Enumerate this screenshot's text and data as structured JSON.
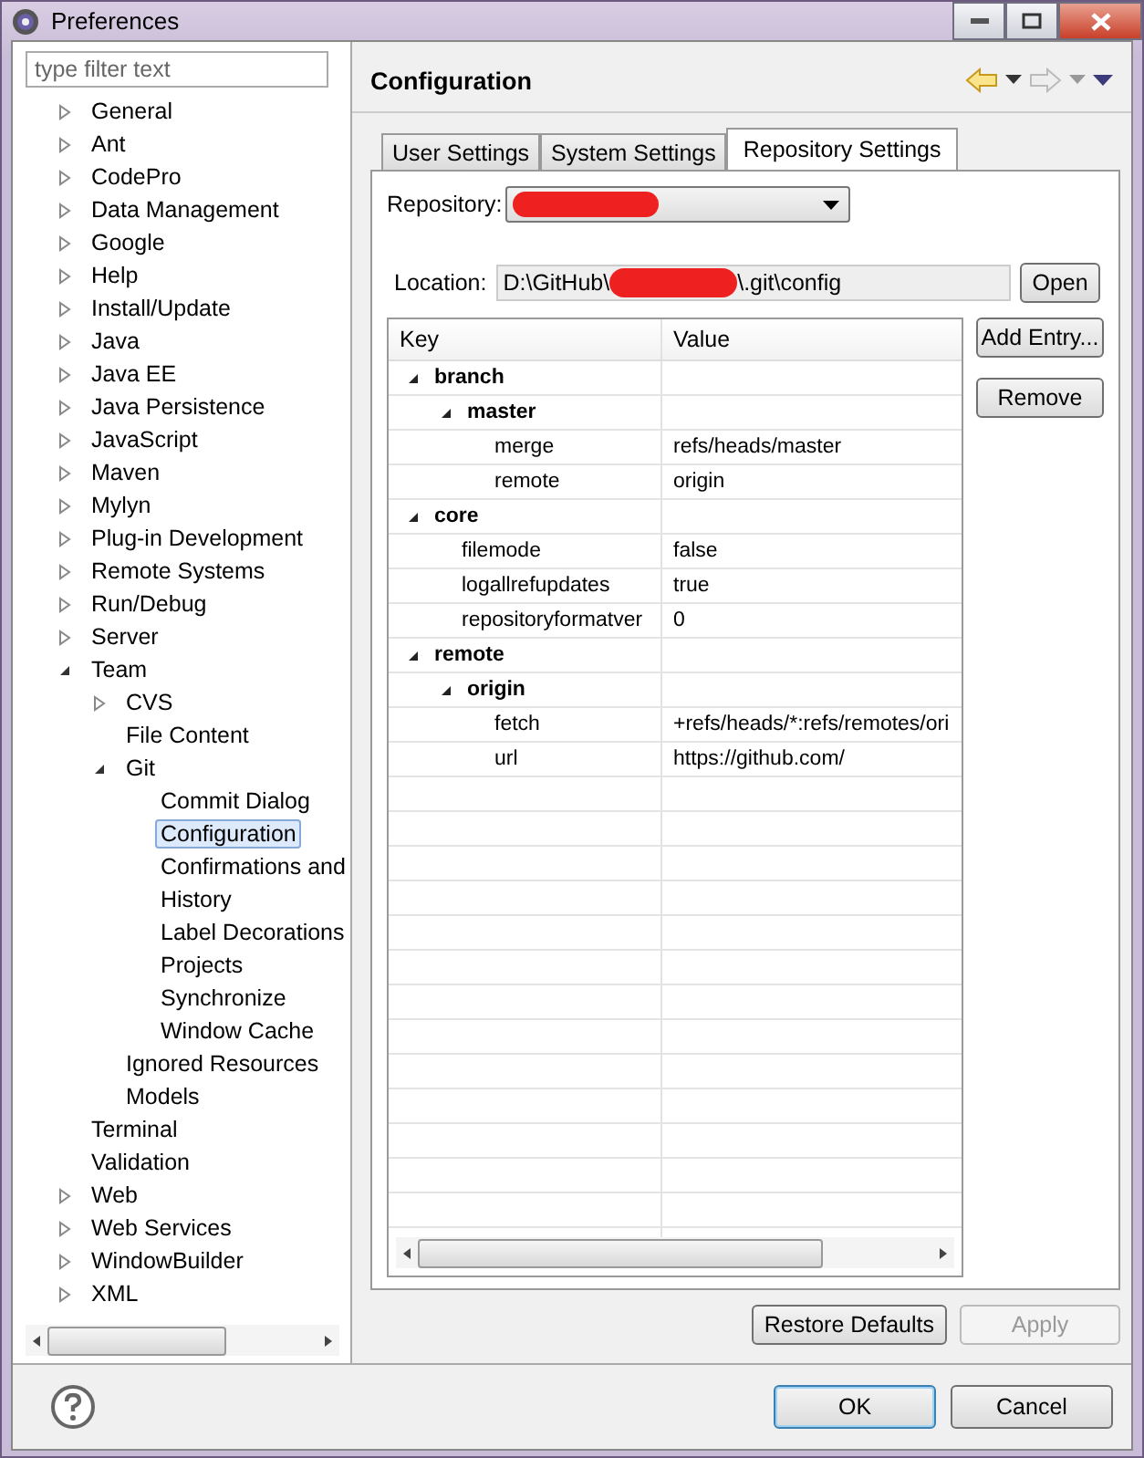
{
  "window": {
    "title": "Preferences"
  },
  "sidebar": {
    "filter": {
      "placeholder": "type filter text"
    },
    "items": [
      {
        "label": "General",
        "expanded": false
      },
      {
        "label": "Ant",
        "expanded": false
      },
      {
        "label": "CodePro",
        "expanded": false
      },
      {
        "label": "Data Management",
        "expanded": false
      },
      {
        "label": "Google",
        "expanded": false
      },
      {
        "label": "Help",
        "expanded": false
      },
      {
        "label": "Install/Update",
        "expanded": false
      },
      {
        "label": "Java",
        "expanded": false
      },
      {
        "label": "Java EE",
        "expanded": false
      },
      {
        "label": "Java Persistence",
        "expanded": false
      },
      {
        "label": "JavaScript",
        "expanded": false
      },
      {
        "label": "Maven",
        "expanded": false
      },
      {
        "label": "Mylyn",
        "expanded": false
      },
      {
        "label": "Plug-in Development",
        "expanded": false
      },
      {
        "label": "Remote Systems",
        "expanded": false
      },
      {
        "label": "Run/Debug",
        "expanded": false
      },
      {
        "label": "Server",
        "expanded": false
      },
      {
        "label": "Team",
        "expanded": true,
        "children": [
          {
            "label": "CVS",
            "expanded": false
          },
          {
            "label": "File Content"
          },
          {
            "label": "Git",
            "expanded": true,
            "children": [
              {
                "label": "Commit Dialog",
                "selected": false
              },
              {
                "label": "Configuration",
                "selected": true
              },
              {
                "label": "Confirmations and",
                "selected": false
              },
              {
                "label": "History",
                "selected": false
              },
              {
                "label": "Label Decorations",
                "selected": false
              },
              {
                "label": "Projects",
                "selected": false
              },
              {
                "label": "Synchronize",
                "selected": false
              },
              {
                "label": "Window Cache",
                "selected": false
              }
            ]
          },
          {
            "label": "Ignored Resources"
          },
          {
            "label": "Models"
          }
        ]
      },
      {
        "label": "Terminal"
      },
      {
        "label": "Validation"
      },
      {
        "label": "Web",
        "expanded": false
      },
      {
        "label": "Web Services",
        "expanded": false
      },
      {
        "label": "WindowBuilder",
        "expanded": false
      },
      {
        "label": "XML",
        "expanded": false
      }
    ]
  },
  "page": {
    "title": "Configuration",
    "tabs": [
      {
        "label": "User Settings",
        "selected": false
      },
      {
        "label": "System Settings",
        "selected": false
      },
      {
        "label": "Repository Settings",
        "selected": true
      }
    ],
    "repository": {
      "label": "Repository:"
    },
    "location": {
      "label": "Location:",
      "value_start": "D:\\GitHub\\",
      "value_end": "\\.git\\config"
    },
    "open_button": "Open",
    "table": {
      "columns": [
        "Key",
        "Value"
      ],
      "rows": [
        {
          "key": "branch",
          "expanded": true,
          "children": [
            {
              "key": "master",
              "expanded": true,
              "children": [
                {
                  "key": "merge",
                  "value": "refs/heads/master"
                },
                {
                  "key": "remote",
                  "value": "origin"
                }
              ]
            }
          ]
        },
        {
          "key": "core",
          "expanded": true,
          "children": [
            {
              "key": "filemode",
              "value": "false"
            },
            {
              "key": "logallrefupdates",
              "value": "true"
            },
            {
              "key": "repositoryformatver",
              "value": "0"
            }
          ]
        },
        {
          "key": "remote",
          "expanded": true,
          "children": [
            {
              "key": "origin",
              "expanded": true,
              "children": [
                {
                  "key": "fetch",
                  "value": "+refs/heads/*:refs/remotes/ori"
                },
                {
                  "key": "url",
                  "value": "https://github.com/"
                }
              ]
            }
          ]
        }
      ]
    },
    "side_buttons": [
      "Add Entry...",
      "Remove"
    ],
    "bottom_buttons": [
      {
        "label": "Restore Defaults",
        "disabled": false
      },
      {
        "label": "Apply",
        "disabled": true
      }
    ]
  },
  "dialog_buttons": [
    {
      "label": "OK",
      "default": true
    },
    {
      "label": "Cancel",
      "default": false
    }
  ]
}
